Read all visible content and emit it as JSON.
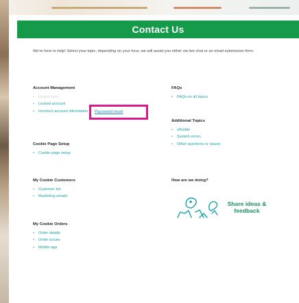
{
  "header": {
    "title": "Contact Us"
  },
  "intro": {
    "text": "We're here to help! Select your topic, depending on your hour, we will assist you either via live chat or an email submission form."
  },
  "sections": {
    "account": {
      "title": "Account Management",
      "items": [
        "Registration",
        "Locked account",
        "Incorrect account information"
      ]
    },
    "cookie_setup": {
      "title": "Cookie Page Setup",
      "items": [
        "Cookie page setup"
      ]
    },
    "cookie_customers": {
      "title": "My Cookie Customers",
      "items": [
        "Customer list",
        "Marketing emails"
      ]
    },
    "cookie_orders": {
      "title": "My Cookie Orders",
      "items": [
        "Order details",
        "Order issues",
        "Mobile app"
      ]
    },
    "faqs": {
      "title": "FAQs",
      "items": [
        "FAQs on all topics"
      ]
    },
    "additional": {
      "title": "Additional Topics",
      "items": [
        "eBudde",
        "System errors",
        "Other questions or issues"
      ]
    },
    "feedback_section": {
      "title": "How are we doing?"
    }
  },
  "highlight": {
    "link_text": "Password reset",
    "border_color": "#d8198e"
  },
  "feedback": {
    "label": "Share ideas & feedback",
    "icon": "share-ideas-icon"
  },
  "colors": {
    "brand_green": "#159a4a",
    "link_teal": "#1aa0a8",
    "feedback_green": "#1c8d5f"
  }
}
